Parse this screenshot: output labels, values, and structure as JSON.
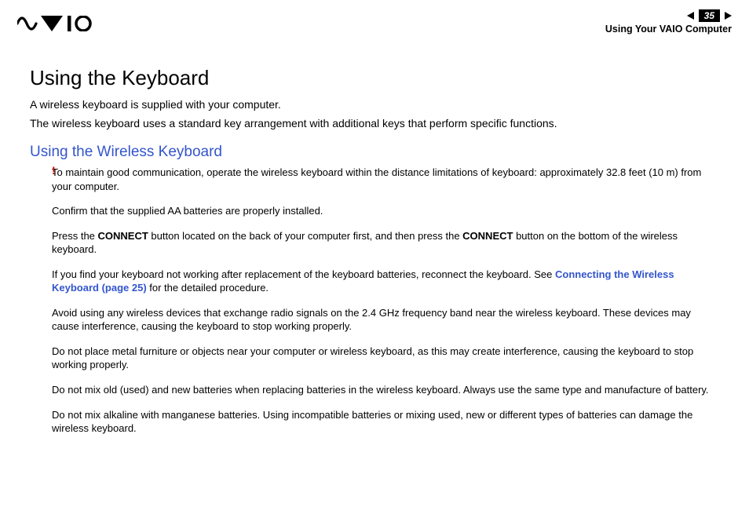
{
  "header": {
    "page_number": "35",
    "breadcrumb": "Using Your VAIO Computer"
  },
  "page": {
    "heading": "Using the Keyboard",
    "intro_line1": "A wireless keyboard is supplied with your computer.",
    "intro_line2": "The wireless keyboard uses a standard key arrangement with additional keys that perform specific functions.",
    "subheading": "Using the Wireless Keyboard",
    "bang": "!",
    "note1": "To maintain good communication, operate the wireless keyboard within the distance limitations of keyboard: approximately 32.8 feet (10 m) from your computer.",
    "note2": "Confirm that the supplied AA batteries are properly installed.",
    "note3_a": "Press the ",
    "note3_b": "CONNECT",
    "note3_c": " button located on the back of your computer first, and then press the ",
    "note3_d": "CONNECT",
    "note3_e": " button on the bottom of the wireless keyboard.",
    "note4_a": "If you find your keyboard not working after replacement of the keyboard batteries, reconnect the keyboard. See ",
    "note4_link": "Connecting the Wireless Keyboard (page 25)",
    "note4_c": " for the detailed procedure.",
    "note5": "Avoid using any wireless devices that exchange radio signals on the 2.4 GHz frequency band near the wireless keyboard. These devices may cause interference, causing the keyboard to stop working properly.",
    "note6": "Do not place metal furniture or objects near your computer or wireless keyboard, as this may create interference, causing the keyboard to stop working properly.",
    "note7": "Do not mix old (used) and new batteries when replacing batteries in the wireless keyboard. Always use the same type and manufacture of battery.",
    "note8": "Do not mix alkaline with manganese batteries. Using incompatible batteries or mixing used, new or different types of batteries can damage the wireless keyboard."
  }
}
